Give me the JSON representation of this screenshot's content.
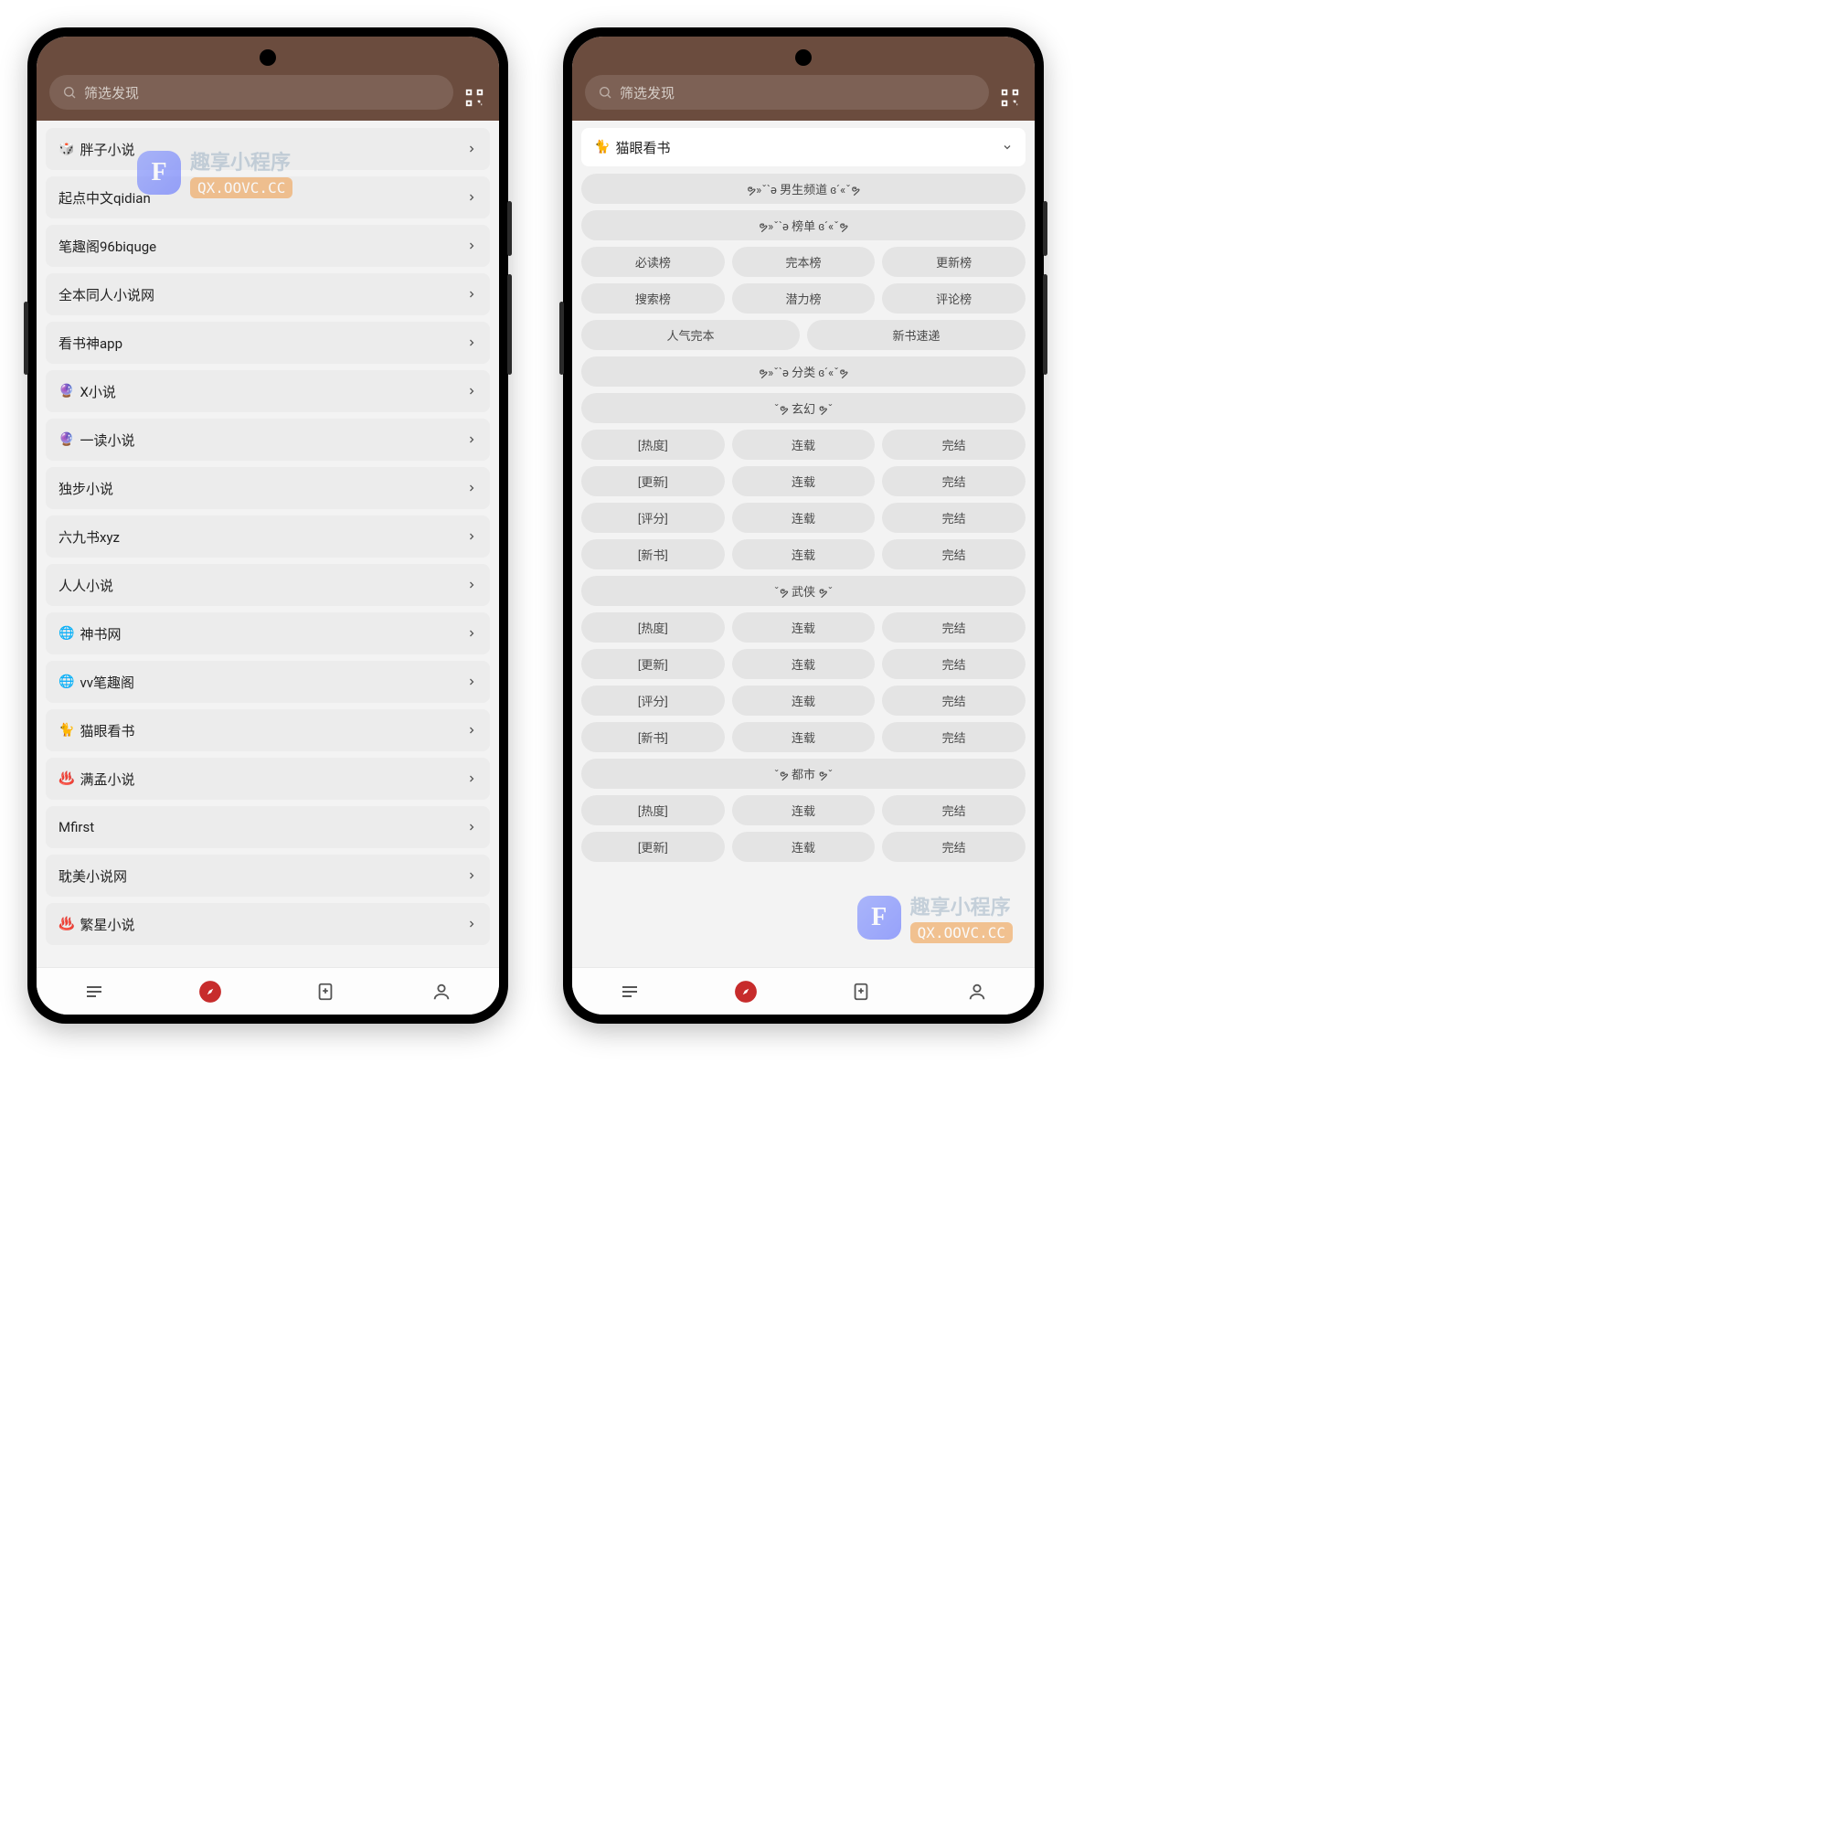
{
  "search": {
    "placeholder": "筛选发现"
  },
  "screen1": {
    "sources": [
      {
        "emoji": "🎲",
        "label": "胖子小说"
      },
      {
        "emoji": "",
        "label": "起点中文qidian"
      },
      {
        "emoji": "",
        "label": "笔趣阁96biquge"
      },
      {
        "emoji": "",
        "label": "全本同人小说网"
      },
      {
        "emoji": "",
        "label": "看书神app"
      },
      {
        "emoji": "🔮",
        "label": "X小说"
      },
      {
        "emoji": "🔮",
        "label": "一读小说"
      },
      {
        "emoji": "",
        "label": "独步小说"
      },
      {
        "emoji": "",
        "label": "六九书xyz"
      },
      {
        "emoji": "",
        "label": "人人小说"
      },
      {
        "emoji": "🌐",
        "label": "神书网"
      },
      {
        "emoji": "🌐",
        "label": "vv笔趣阁"
      },
      {
        "emoji": "🐈",
        "label": "猫眼看书"
      },
      {
        "emoji": "♨️",
        "label": "满孟小说"
      },
      {
        "emoji": "",
        "label": "Mfirst"
      },
      {
        "emoji": "",
        "label": "耽美小说网"
      },
      {
        "emoji": "♨️",
        "label": "繁星小说"
      }
    ]
  },
  "screen2": {
    "header": {
      "emoji": "🐈",
      "label": "猫眼看书"
    },
    "decor": {
      "boys_channel": "ຯ»ˇ`ə 男生频道 ɞ´«ˇຯ",
      "rank_header": "ຯ»ˇ`ə 榜单 ɞ´«ˇຯ",
      "cat_header": "ຯ»ˇ`ə 分类 ɞ´«ˇຯ",
      "xuanhuan": "ˇຯ 玄幻 ຯˇ",
      "wuxia": "ˇຯ 武侠 ຯˇ",
      "dushi": "ˇຯ 都市 ຯˇ"
    },
    "ranks_row1": [
      "必读榜",
      "完本榜",
      "更新榜"
    ],
    "ranks_row2": [
      "搜索榜",
      "潜力榜",
      "评论榜"
    ],
    "ranks_row3": [
      "人气完本",
      "新书速递"
    ],
    "sort_rows": [
      [
        "[热度]",
        "连载",
        "完结"
      ],
      [
        "[更新]",
        "连载",
        "完结"
      ],
      [
        "[评分]",
        "连载",
        "完结"
      ],
      [
        "[新书]",
        "连载",
        "完结"
      ]
    ]
  },
  "watermark": {
    "logo": "F",
    "title": "趣享小程序",
    "url": "QX.OOVC.CC"
  }
}
